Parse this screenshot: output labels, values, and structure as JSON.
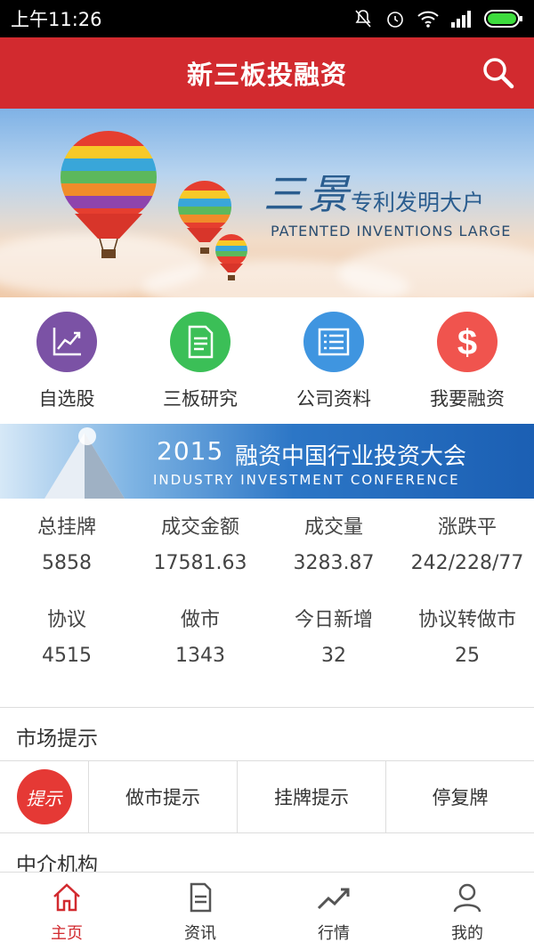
{
  "status_bar": {
    "time": "上午11:26"
  },
  "header": {
    "title": "新三板投融资"
  },
  "banner1": {
    "brand": "三景",
    "tag_cn": "专利发明大户",
    "tag_en": "PATENTED INVENTIONS LARGE"
  },
  "quick_links": [
    {
      "label": "自选股",
      "icon": "chart-trend-icon",
      "color": "#7b52a5"
    },
    {
      "label": "三板研究",
      "icon": "document-icon",
      "color": "#3bbf57"
    },
    {
      "label": "公司资料",
      "icon": "list-icon",
      "color": "#3f95e0"
    },
    {
      "label": "我要融资",
      "icon": "dollar-icon",
      "color": "#f0544e"
    }
  ],
  "banner2": {
    "year": "2015",
    "title_cn": "融资中国行业投资大会",
    "title_en": "INDUSTRY INVESTMENT CONFERENCE"
  },
  "stats": [
    {
      "label": "总挂牌",
      "value": "5858"
    },
    {
      "label": "成交金额",
      "value": "17581.63"
    },
    {
      "label": "成交量",
      "value": "3283.87"
    },
    {
      "label": "涨跌平",
      "value": "242/228/77"
    },
    {
      "label": "协议",
      "value": "4515"
    },
    {
      "label": "做市",
      "value": "1343"
    },
    {
      "label": "今日新增",
      "value": "32"
    },
    {
      "label": "协议转做市",
      "value": "25"
    }
  ],
  "market_hints": {
    "title": "市场提示",
    "badge": "提示",
    "items": [
      "做市提示",
      "挂牌提示",
      "停复牌"
    ]
  },
  "agencies": {
    "title": "中介机构"
  },
  "bottom_nav": [
    {
      "label": "主页",
      "icon": "home-icon",
      "active": true
    },
    {
      "label": "资讯",
      "icon": "news-icon",
      "active": false
    },
    {
      "label": "行情",
      "icon": "trend-icon",
      "active": false
    },
    {
      "label": "我的",
      "icon": "user-icon",
      "active": false
    }
  ],
  "colors": {
    "primary": "#d22a2f"
  }
}
